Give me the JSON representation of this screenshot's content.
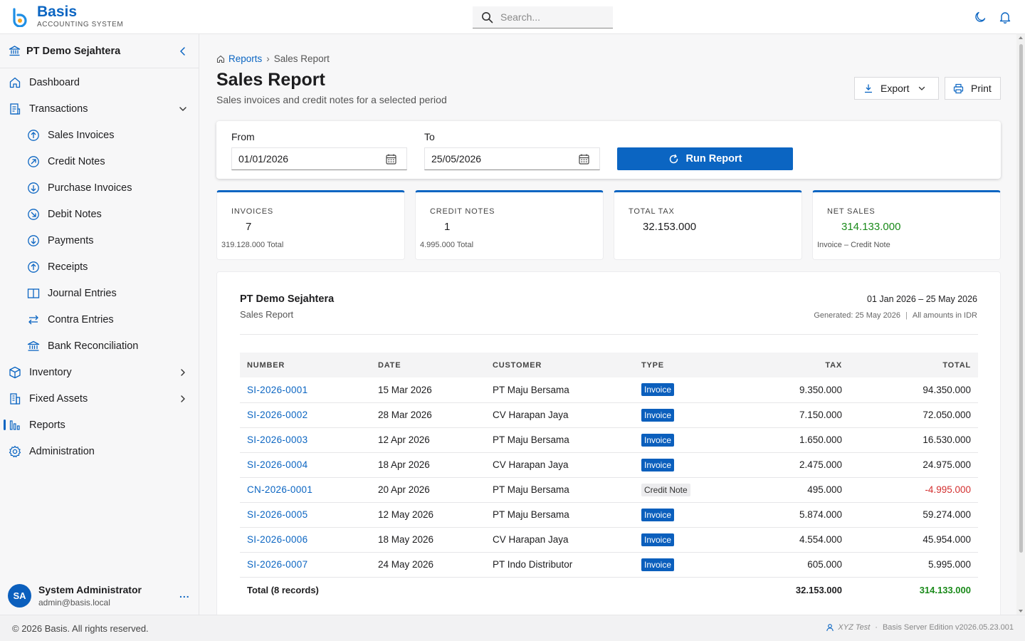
{
  "app": {
    "name": "Basis",
    "subtitle": "ACCOUNTING SYSTEM",
    "accent": "#0b65c2"
  },
  "search": {
    "placeholder": "Search..."
  },
  "sidebar": {
    "org_name": "PT Demo Sejahtera",
    "items": [
      {
        "label": "Dashboard",
        "icon": "home-icon"
      },
      {
        "label": "Transactions",
        "icon": "document-icon"
      },
      {
        "label": "Sales Invoices",
        "icon": "arrow-circle-up-icon"
      },
      {
        "label": "Credit Notes",
        "icon": "arrow-circle-up-right-icon"
      },
      {
        "label": "Purchase Invoices",
        "icon": "arrow-circle-down-icon"
      },
      {
        "label": "Debit Notes",
        "icon": "arrow-circle-down-right-icon"
      },
      {
        "label": "Payments",
        "icon": "arrow-circle-down-icon"
      },
      {
        "label": "Receipts",
        "icon": "arrow-circle-up-icon"
      },
      {
        "label": "Journal Entries",
        "icon": "book-icon"
      },
      {
        "label": "Contra Entries",
        "icon": "swap-icon"
      },
      {
        "label": "Bank Reconciliation",
        "icon": "bank-icon"
      },
      {
        "label": "Inventory",
        "icon": "box-icon"
      },
      {
        "label": "Fixed Assets",
        "icon": "building-icon"
      },
      {
        "label": "Reports",
        "icon": "chart-bars-icon"
      },
      {
        "label": "Administration",
        "icon": "gear-icon"
      }
    ]
  },
  "user": {
    "initials": "SA",
    "name": "System Administrator",
    "email": "admin@basis.local",
    "more": "..."
  },
  "breadcrumb": {
    "root": "Reports",
    "sep": "›",
    "current": "Sales Report"
  },
  "page": {
    "title": "Sales Report",
    "subtitle": "Sales invoices and credit notes for a selected period"
  },
  "actions": {
    "export": "Export",
    "print": "Print"
  },
  "filter": {
    "from_label": "From",
    "from_value": "01/01/2026",
    "to_label": "To",
    "to_value": "25/05/2026",
    "run_label": "Run Report"
  },
  "kpis": [
    {
      "label": "INVOICES",
      "value": "7",
      "note": "319.128.000 Total"
    },
    {
      "label": "CREDIT NOTES",
      "value": "1",
      "note": "4.995.000 Total"
    },
    {
      "label": "TOTAL TAX",
      "value": "32.153.000",
      "note": ""
    },
    {
      "label": "NET SALES",
      "value": "314.133.000",
      "note": "Invoice – Credit Note",
      "color": "#1a8a1a"
    }
  ],
  "report": {
    "org": "PT Demo Sejahtera",
    "title": "Sales Report",
    "range": "01 Jan 2026 – 25 May 2026",
    "generated": "Generated: 25 May 2026",
    "meta_sep": "|",
    "currency_note": "All amounts in IDR",
    "columns": [
      "NUMBER",
      "DATE",
      "CUSTOMER",
      "TYPE",
      "TAX",
      "TOTAL"
    ],
    "rows": [
      {
        "number": "SI-2026-0001",
        "date": "15 Mar 2026",
        "customer": "PT Maju Bersama",
        "type": "Invoice",
        "tax": "9.350.000",
        "total": "94.350.000"
      },
      {
        "number": "SI-2026-0002",
        "date": "28 Mar 2026",
        "customer": "CV Harapan Jaya",
        "type": "Invoice",
        "tax": "7.150.000",
        "total": "72.050.000"
      },
      {
        "number": "SI-2026-0003",
        "date": "12 Apr 2026",
        "customer": "PT Maju Bersama",
        "type": "Invoice",
        "tax": "1.650.000",
        "total": "16.530.000"
      },
      {
        "number": "SI-2026-0004",
        "date": "18 Apr 2026",
        "customer": "CV Harapan Jaya",
        "type": "Invoice",
        "tax": "2.475.000",
        "total": "24.975.000"
      },
      {
        "number": "CN-2026-0001",
        "date": "20 Apr 2026",
        "customer": "PT Maju Bersama",
        "type": "Credit Note",
        "tax": "495.000",
        "total": "-4.995.000"
      },
      {
        "number": "SI-2026-0005",
        "date": "12 May 2026",
        "customer": "PT Maju Bersama",
        "type": "Invoice",
        "tax": "5.874.000",
        "total": "59.274.000"
      },
      {
        "number": "SI-2026-0006",
        "date": "18 May 2026",
        "customer": "CV Harapan Jaya",
        "type": "Invoice",
        "tax": "4.554.000",
        "total": "45.954.000"
      },
      {
        "number": "SI-2026-0007",
        "date": "24 May 2026",
        "customer": "PT Indo Distributor",
        "type": "Invoice",
        "tax": "605.000",
        "total": "5.995.000"
      }
    ],
    "total_label": "Total (8 records)",
    "total_tax": "32.153.000",
    "total_total": "314.133.000"
  },
  "footer": {
    "copyright": "© 2026 Basis. All rights reserved.",
    "tenant": "XYZ Test",
    "dot": "·",
    "edition": "Basis Server Edition v2026.05.23.001"
  }
}
